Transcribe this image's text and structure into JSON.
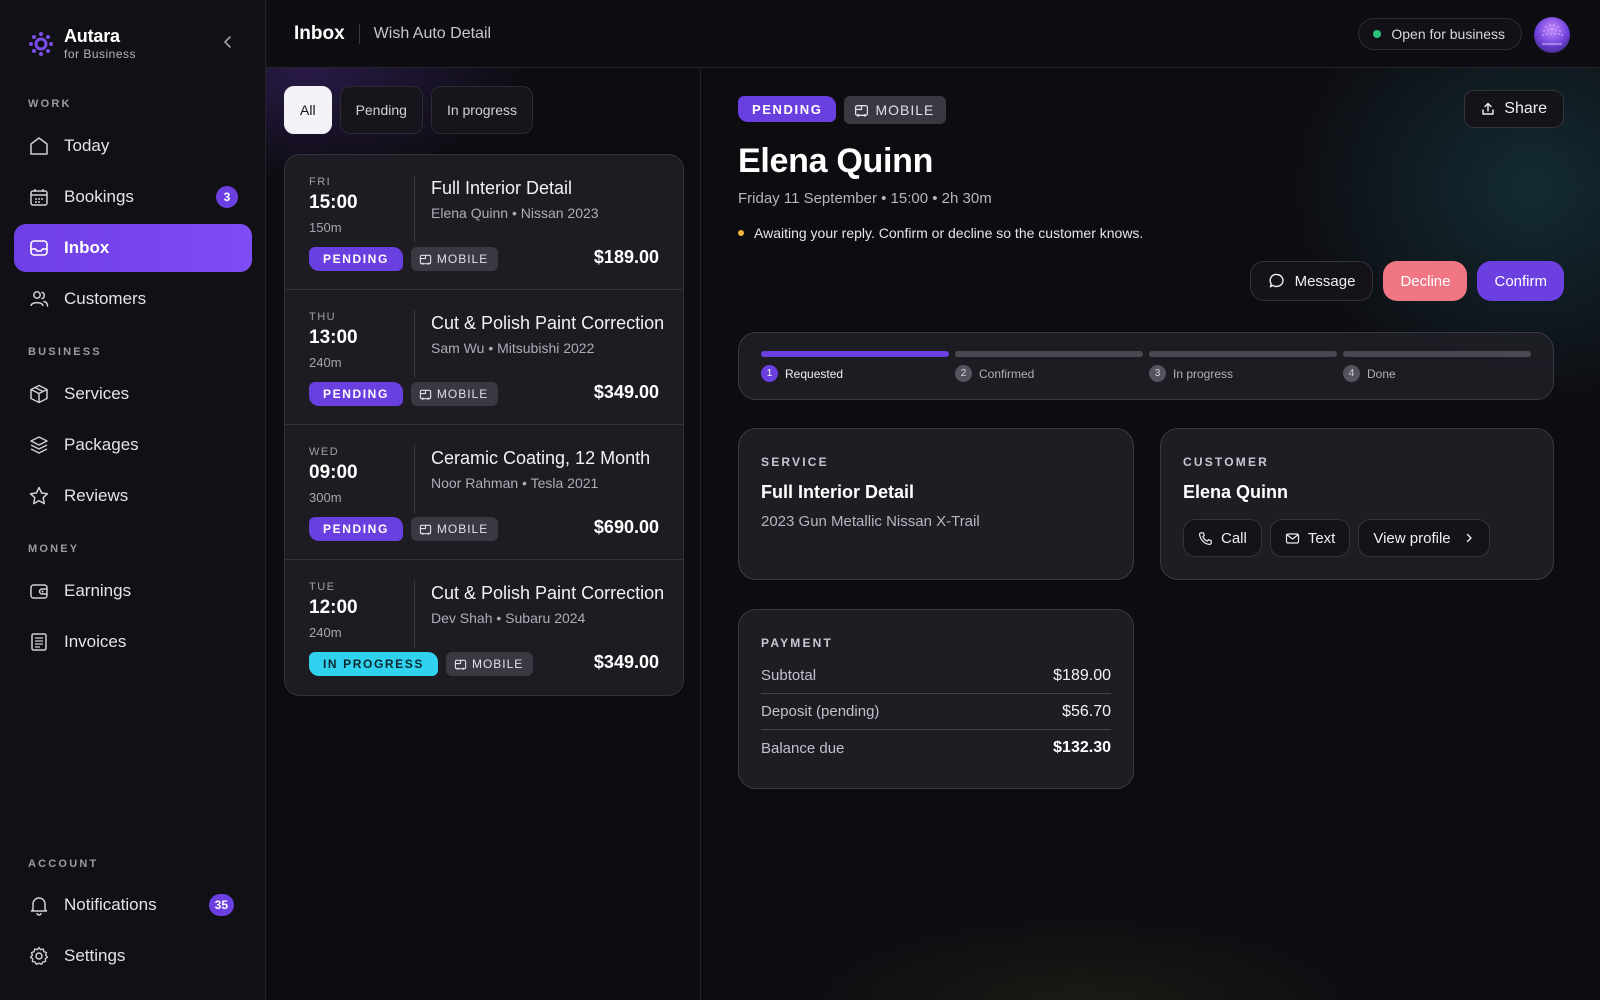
{
  "brand": {
    "name": "Autara",
    "sub": "for Business"
  },
  "sidebar": {
    "sections": {
      "work": "WORK",
      "business": "BUSINESS",
      "money": "MONEY",
      "account": "ACCOUNT"
    },
    "items": {
      "today": {
        "label": "Today",
        "icon": "home-icon"
      },
      "bookings": {
        "label": "Bookings",
        "icon": "calendar-icon",
        "badge": "3"
      },
      "inbox": {
        "label": "Inbox",
        "icon": "inbox-icon",
        "active": true
      },
      "customers": {
        "label": "Customers",
        "icon": "users-icon"
      },
      "services": {
        "label": "Services",
        "icon": "box-icon"
      },
      "packages": {
        "label": "Packages",
        "icon": "layers-icon"
      },
      "reviews": {
        "label": "Reviews",
        "icon": "star-icon"
      },
      "earnings": {
        "label": "Earnings",
        "icon": "wallet-icon"
      },
      "invoices": {
        "label": "Invoices",
        "icon": "invoice-icon"
      },
      "notifications": {
        "label": "Notifications",
        "icon": "bell-icon",
        "badge": "35"
      },
      "settings": {
        "label": "Settings",
        "icon": "gear-icon"
      }
    }
  },
  "header": {
    "title": "Inbox",
    "subtitle": "Wish Auto Detail",
    "status": "Open for business",
    "status_color": "#2ec27e"
  },
  "filters": [
    {
      "label": "All",
      "active": true
    },
    {
      "label": "Pending"
    },
    {
      "label": "In progress"
    }
  ],
  "bookings": [
    {
      "day": "FRI",
      "time": "15:00",
      "duration": "150m",
      "title": "Full Interior Detail",
      "meta": "Elena Quinn • Nissan 2023",
      "status": "PENDING",
      "location": "MOBILE",
      "price": "$189.00"
    },
    {
      "day": "THU",
      "time": "13:00",
      "duration": "240m",
      "title": "Cut & Polish Paint Correction",
      "meta": "Sam Wu • Mitsubishi 2022",
      "status": "PENDING",
      "location": "MOBILE",
      "price": "$349.00"
    },
    {
      "day": "WED",
      "time": "09:00",
      "duration": "300m",
      "title": "Ceramic Coating, 12 Month",
      "meta": "Noor Rahman • Tesla 2021",
      "status": "PENDING",
      "location": "MOBILE",
      "price": "$690.00"
    },
    {
      "day": "TUE",
      "time": "12:00",
      "duration": "240m",
      "title": "Cut & Polish Paint Correction",
      "meta": "Dev Shah • Subaru 2024",
      "status": "IN PROGRESS",
      "location": "MOBILE",
      "price": "$349.00"
    }
  ],
  "detail": {
    "status": "PENDING",
    "location": "MOBILE",
    "share_label": "Share",
    "customer_name": "Elena Quinn",
    "when": "Friday 11 September • 15:00 • 2h 30m",
    "notice": "Awaiting your reply. Confirm or decline so the customer knows.",
    "actions": {
      "message": "Message",
      "decline": "Decline",
      "confirm": "Confirm"
    },
    "steps": [
      {
        "num": "1",
        "label": "Requested",
        "complete": true
      },
      {
        "num": "2",
        "label": "Confirmed",
        "complete": false
      },
      {
        "num": "3",
        "label": "In progress",
        "complete": false
      },
      {
        "num": "4",
        "label": "Done",
        "complete": false
      }
    ],
    "service": {
      "label": "SERVICE",
      "title": "Full Interior Detail",
      "vehicle": "2023 Gun Metallic Nissan X-Trail"
    },
    "customer": {
      "label": "CUSTOMER",
      "name": "Elena Quinn",
      "call": "Call",
      "text": "Text",
      "profile": "View profile"
    },
    "payment": {
      "label": "PAYMENT",
      "rows": [
        {
          "label": "Subtotal",
          "value": "$189.00"
        },
        {
          "label": "Deposit (pending)",
          "value": "$56.70"
        },
        {
          "label": "Balance due",
          "value": "$132.30"
        }
      ]
    }
  },
  "colors": {
    "accent": "#6b3fe0",
    "decline": "#f07684",
    "in_progress": "#2fd3f0",
    "notice_dot": "#f2b640"
  }
}
